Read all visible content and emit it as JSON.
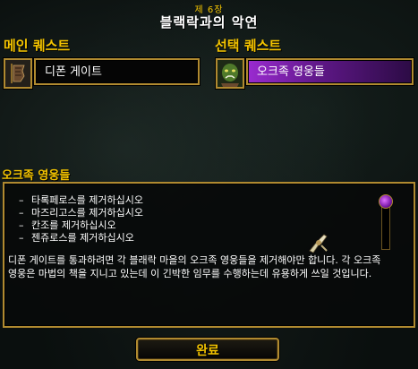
{
  "header": {
    "chapter": "제 6장",
    "title": "블랙락과의 악연"
  },
  "sections": {
    "main_label": "메인 퀘스트",
    "optional_label": "선택 퀘스트"
  },
  "main_quest": {
    "icon": "torn-banner-icon",
    "name": "디폰 게이트"
  },
  "optional_quest": {
    "icon": "orc-portrait-icon",
    "name": "오크족 영웅들",
    "highlight_color": "#9a2bd0"
  },
  "detail": {
    "title": "오크족 영웅들",
    "objectives": [
      "타록페로스를 제거하십시오",
      "마즈리고스를 제거하십시오",
      "칸조를 제거하십시오",
      "젠쥬로스를 제거하십시오"
    ],
    "description": "디폰 게이트를 통과하려면 각 블래락 마을의 오크족 영웅들을 제거해야만 합니다. 각 오크족 영웅은 마법의 책을 지니고 있는데 이 긴박한 임무를 수행하는데 유용하게 쓰일 것입니다."
  },
  "footer": {
    "done_label": "완료"
  },
  "colors": {
    "accent_gold": "#f4c400",
    "frame_gold": "#b08a30"
  }
}
